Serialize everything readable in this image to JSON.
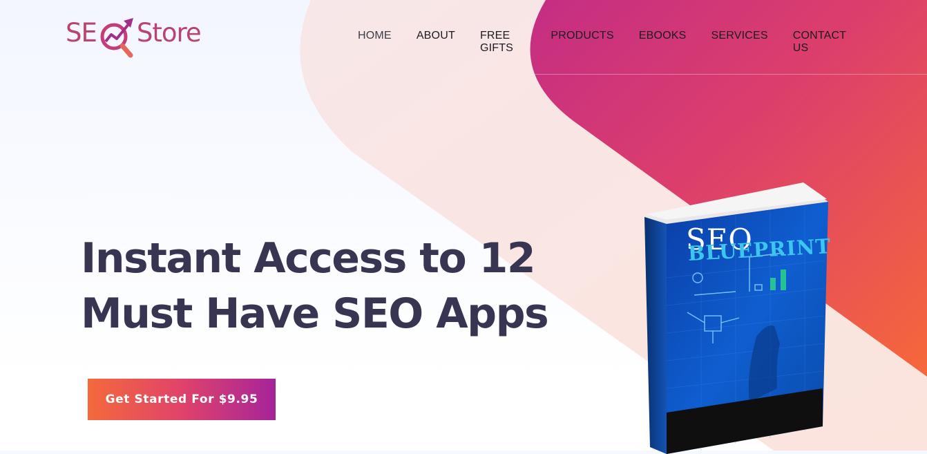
{
  "brand": {
    "logo_pre": "SE",
    "logo_post": "Store"
  },
  "nav": {
    "items": [
      {
        "label": "HOME",
        "active": true
      },
      {
        "label": "ABOUT"
      },
      {
        "label": "FREE GIFTS"
      },
      {
        "label": "PRODUCTS"
      },
      {
        "label": "EBOOKS"
      },
      {
        "label": "SERVICES"
      },
      {
        "label": "CONTACT US"
      }
    ]
  },
  "hero": {
    "title": "Instant Access to 12 Must Have SEO Apps",
    "cta_label": "Get Started For $9.95"
  },
  "book": {
    "title_line1": "SEO",
    "title_line2": "BLUEPRINT"
  },
  "colors": {
    "accent_orange": "#f4693c",
    "accent_pink": "#d33c6f",
    "accent_purple": "#a5249a",
    "heading": "#383552"
  },
  "icons": {
    "logo": "magnifier-chart-arrow-icon"
  }
}
